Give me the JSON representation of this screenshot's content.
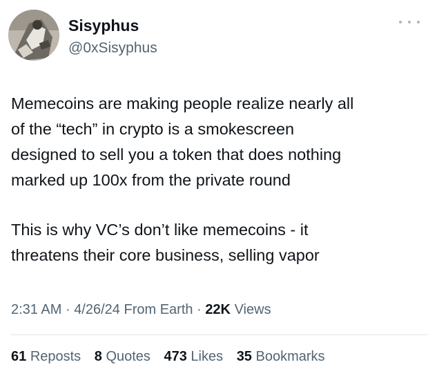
{
  "author": {
    "name": "Sisyphus",
    "handle": "@0xSisyphus",
    "avatar_icon": "avatar-photo"
  },
  "more_icon": "ellipsis-icon",
  "tweet": {
    "paragraphs": [
      "Memecoins are making people realize nearly all\nof the “tech” in crypto is a smokescreen\ndesigned to sell you a token that does nothing\nmarked up 100x from the private round",
      "This is why VC’s don’t like memecoins - it\nthreatens their core business, selling vapor"
    ]
  },
  "meta": {
    "time": "2:31 AM",
    "sep1": "·",
    "date": "4/26/24",
    "source": "From Earth",
    "sep2": "·",
    "views_count": "22K",
    "views_label": "Views"
  },
  "stats": {
    "reposts": {
      "count": "61",
      "label": "Reposts"
    },
    "quotes": {
      "count": "8",
      "label": "Quotes"
    },
    "likes": {
      "count": "473",
      "label": "Likes"
    },
    "bookmarks": {
      "count": "35",
      "label": "Bookmarks"
    }
  },
  "colors": {
    "text": "#0f1419",
    "secondary": "#536471",
    "divider": "#dfe3e7"
  }
}
